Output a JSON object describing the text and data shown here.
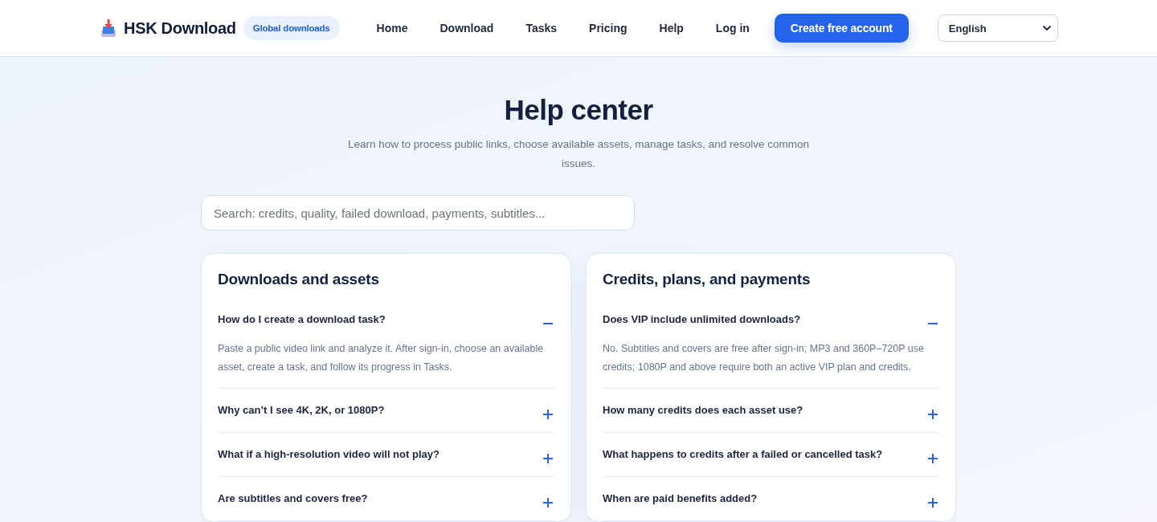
{
  "header": {
    "brand": "HSK Download",
    "badge": "Global downloads",
    "nav": [
      "Home",
      "Download",
      "Tasks",
      "Pricing",
      "Help",
      "Log in"
    ],
    "cta": "Create free account",
    "language": "English"
  },
  "hero": {
    "title": "Help center",
    "subtitle": "Learn how to process public links, choose available assets, manage tasks, and resolve common issues."
  },
  "search": {
    "placeholder": "Search: credits, quality, failed download, payments, subtitles..."
  },
  "sections": [
    {
      "title": "Downloads and assets",
      "items": [
        {
          "question": "How do I create a download task?",
          "expanded": true,
          "answer": "Paste a public video link and analyze it. After sign-in, choose an available asset, create a task, and follow its progress in Tasks."
        },
        {
          "question": "Why can’t I see 4K, 2K, or 1080P?",
          "expanded": false
        },
        {
          "question": "What if a high-resolution video will not play?",
          "expanded": false
        },
        {
          "question": "Are subtitles and covers free?",
          "expanded": false
        }
      ]
    },
    {
      "title": "Credits, plans, and payments",
      "items": [
        {
          "question": "Does VIP include unlimited downloads?",
          "expanded": true,
          "answer": "No. Subtitles and covers are free after sign-in; MP3 and 360P–720P use credits; 1080P and above require both an active VIP plan and credits."
        },
        {
          "question": "How many credits does each asset use?",
          "expanded": false
        },
        {
          "question": "What happens to credits after a failed or cancelled task?",
          "expanded": false
        },
        {
          "question": "When are paid benefits added?",
          "expanded": false
        }
      ]
    }
  ]
}
